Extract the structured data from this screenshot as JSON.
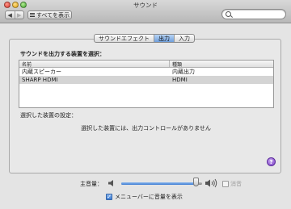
{
  "window": {
    "title": "サウンド"
  },
  "toolbar": {
    "back_icon": "◀",
    "forward_icon": "▶",
    "show_all_label": "すべてを表示",
    "search_placeholder": ""
  },
  "tabs": [
    {
      "label": "サウンドエフェクト",
      "active": false
    },
    {
      "label": "出力",
      "active": true
    },
    {
      "label": "入力",
      "active": false
    }
  ],
  "output": {
    "heading": "サウンドを出力する装置を選択：",
    "columns": [
      "名前",
      "種類"
    ],
    "devices": [
      {
        "name": "内蔵スピーカー",
        "type": "内蔵出力",
        "selected": false
      },
      {
        "name": "SHARP HDMI",
        "type": "HDMI",
        "selected": true
      }
    ],
    "settings_label": "選択した装置の設定：",
    "no_controls_message": "選択した装置には、出力コントロールがありません",
    "help_label": "?"
  },
  "volume": {
    "label": "主音量：",
    "level": 0.92,
    "mute_label": "消音",
    "mute_checked": false
  },
  "menubar_option": {
    "label": "メニューバーに音量を表示",
    "checked": true,
    "check_glyph": "✓"
  },
  "colors": {
    "accent": "#3c7bd2",
    "selected_row": "#d4d4d4",
    "help_button": "#7b3fc6"
  }
}
